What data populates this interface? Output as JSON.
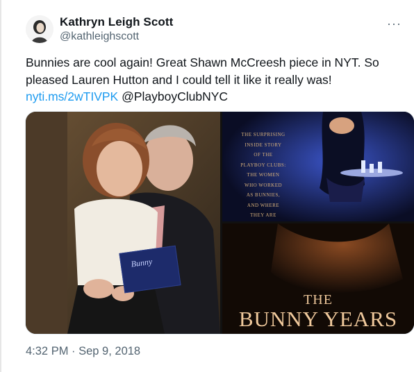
{
  "author": {
    "name": "Kathryn Leigh Scott",
    "handle": "@kathleighscott"
  },
  "more_label": "···",
  "tweet": {
    "text_line1": "Bunnies are cool again! Great Shawn McCreesh piece in NYT.  So",
    "text_line2": "pleased Lauren Hutton and I could tell it like it really was!",
    "link": "nyti.ms/2wTIVPK",
    "mention": "@PlayboyClubNYC"
  },
  "media": {
    "book_tagline": [
      "THE SURPRISING",
      "INSIDE STORY",
      "OF THE",
      "PLAYBOY CLUBS:",
      "THE WOMEN",
      "WHO WORKED",
      "AS BUNNIES,",
      "AND WHERE",
      "THEY ARE"
    ],
    "book_title_the": "THE",
    "book_title_main": "BUNNY YEARS",
    "held_book_text": "Bunny"
  },
  "timestamp": "4:32 PM · Sep 9, 2018",
  "colors": {
    "text": "#0f1419",
    "secondary": "#536471",
    "link": "#1d9bf0"
  }
}
